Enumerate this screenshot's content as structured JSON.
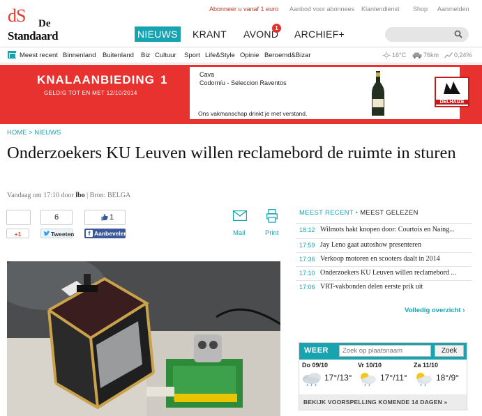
{
  "topbar": {
    "subscribe": "Abonneer u vanaf 1 euro",
    "offer": "Aanbod voor abonnees",
    "service": "Klantendienst",
    "shop": "Shop",
    "login": "Aanmelden"
  },
  "logo": {
    "line1": "dS",
    "line1b": "De",
    "line2": "Standaard"
  },
  "nav": {
    "items": [
      "NIEUWS",
      "KRANT",
      "AVOND",
      "ARCHIEF+"
    ],
    "avond_badge": "1",
    "search_placeholder": ""
  },
  "sections": {
    "items": [
      "Meest recent",
      "Binnenland",
      "Buitenland",
      "Biz",
      "Cultuur",
      "Sport",
      "Life&Style",
      "Opinie",
      "Beroemd&Bizar"
    ],
    "temperature": "16°C",
    "traffic": "76km",
    "market": "0,24%"
  },
  "ad": {
    "title": "KNALAANBIEDING",
    "number": "1",
    "valid": "GELDIG TOT EN MET 12/10/2014",
    "brand_line1": "Cava",
    "brand_line2": "Codorníu - Seleccion Raventos",
    "slogan": "Ons vakmanschap drinkt je met verstand.",
    "store": "DELHAIZE"
  },
  "breadcrumb": "HOME > NIEUWS",
  "article": {
    "title": "Onderzoekers KU Leuven willen reclamebord de ruimte in sturen",
    "meta_prefix": "Vandaag om 17:10 door ",
    "author": "lbo",
    "meta_suffix": " | Bron: BELGA"
  },
  "share": {
    "gplus_count": "",
    "gplus_label": "+1",
    "tweet_count": "6",
    "tweet_label": "Tweeten",
    "like_count": "1",
    "like_label": "Aanbevelen",
    "mail_label": "Mail",
    "print_label": "Print"
  },
  "recent": {
    "tab_active": "MEEST RECENT",
    "tab_other": "MEEST GELEZEN",
    "items": [
      {
        "time": "18:12",
        "headline": "Wilmots hakt knopen door: Courtois en Naing..."
      },
      {
        "time": "17:59",
        "headline": "Jay Leno gaat autoshow presenteren"
      },
      {
        "time": "17:36",
        "headline": "Verkoop motoren en scooters daalt in 2014"
      },
      {
        "time": "17:10",
        "headline": "Onderzoekers KU Leuven willen reclamebord ..."
      },
      {
        "time": "17:06",
        "headline": "VRT-vakbonden delen eerste prik uit"
      }
    ],
    "overview": "Volledig overzicht ›"
  },
  "weather": {
    "label": "WEER",
    "placeholder": "Zoek op plaatsnaam",
    "button": "Zoek",
    "days": [
      {
        "name": "Do 09/10",
        "temps": "17°/13°",
        "icon": "rain-cloud-icon"
      },
      {
        "name": "Vr 10/10",
        "temps": "17°/11°",
        "icon": "sun-rain-icon"
      },
      {
        "name": "Za 11/10",
        "temps": "18°/9°",
        "icon": "sun-rain-icon"
      }
    ],
    "forecast_link": "BEKIJK VOORSPELLING KOMENDE 14 DAGEN »"
  },
  "colors": {
    "accent": "#17a3b0",
    "ad_red": "#e8322f",
    "logo_red": "#e63b2e"
  }
}
